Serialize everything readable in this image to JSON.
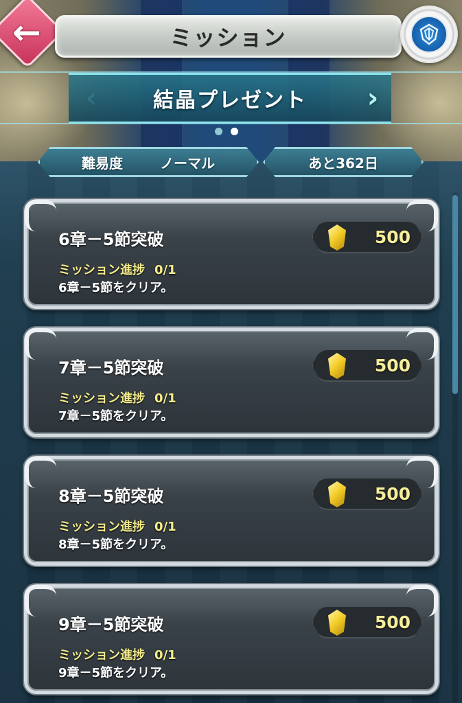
{
  "header": {
    "title": "ミッション",
    "back_icon": "back-arrow-icon",
    "emblem_icon": "game-emblem-icon"
  },
  "banner": {
    "title": "結晶プレゼント",
    "left_arrow": "‹",
    "right_arrow": "›",
    "page_count": 2,
    "active_page": 2
  },
  "info": {
    "difficulty_label": "難易度",
    "difficulty_value": "ノーマル",
    "remaining": "あと362日"
  },
  "colors": {
    "accent": "#9fd7e1",
    "progress_text": "#f3ec8a",
    "reward_text": "#f6ee9a",
    "back_button": "#e2517a"
  },
  "missions": [
    {
      "title": "6章－5節突破",
      "progress_label": "ミッション進捗",
      "progress_value": "0/1",
      "description": "6章－5節をクリア。",
      "reward_icon": "orb-icon",
      "reward_amount": "500"
    },
    {
      "title": "7章－5節突破",
      "progress_label": "ミッション進捗",
      "progress_value": "0/1",
      "description": "7章－5節をクリア。",
      "reward_icon": "orb-icon",
      "reward_amount": "500"
    },
    {
      "title": "8章－5節突破",
      "progress_label": "ミッション進捗",
      "progress_value": "0/1",
      "description": "8章－5節をクリア。",
      "reward_icon": "orb-icon",
      "reward_amount": "500"
    },
    {
      "title": "9章－5節突破",
      "progress_label": "ミッション進捗",
      "progress_value": "0/1",
      "description": "9章－5節をクリア。",
      "reward_icon": "orb-icon",
      "reward_amount": "500"
    }
  ]
}
